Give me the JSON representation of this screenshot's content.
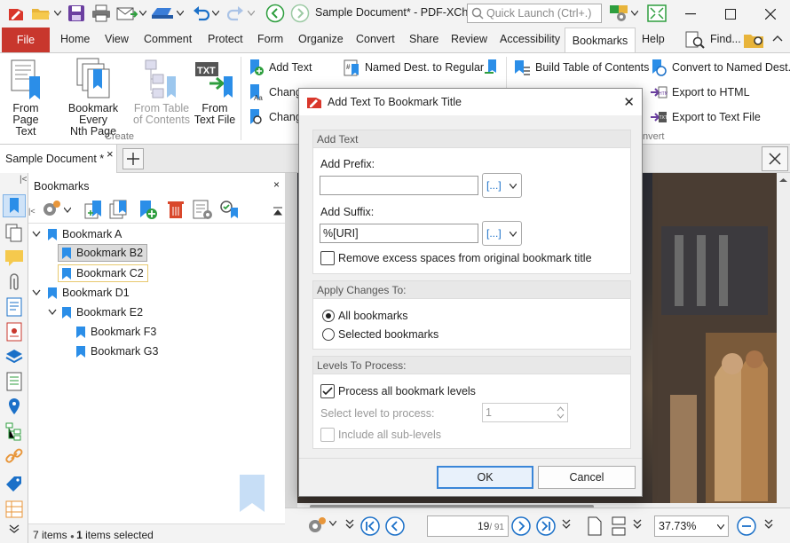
{
  "window": {
    "title": "Sample Document* - PDF-XCh...",
    "quick_launch_placeholder": "Quick Launch (Ctrl+.)"
  },
  "menu": {
    "file": "File",
    "tabs": [
      "Home",
      "View",
      "Comment",
      "Protect",
      "Form",
      "Organize",
      "Convert",
      "Share",
      "Review",
      "Accessibility"
    ],
    "active_tab": "Bookmarks",
    "help": "Help",
    "find": "Find..."
  },
  "ribbon": {
    "create": {
      "from_page_text_1": "From",
      "from_page_text_2": "Page Text",
      "every_nth_1": "Bookmark Every",
      "every_nth_2": "Nth Page",
      "from_toc_1": "From Table",
      "from_toc_2": "of Contents",
      "from_text_file_1": "From",
      "from_text_file_2": "Text File",
      "group_label": "Create"
    },
    "edit": {
      "add_text": "Add Text",
      "change_1": "Chang",
      "change_2": "Chang",
      "named_dest_to_regular": "Named Dest. to Regular",
      "build_toc": "Build Table of Contents",
      "convert_to_named_dest": "Convert to Named Dest.",
      "export_html": "Export to HTML",
      "export_text": "Export to Text File",
      "convert_group_label": "nvert"
    }
  },
  "doc_tab": {
    "label": "Sample Document *"
  },
  "bookmarks_panel": {
    "title": "Bookmarks",
    "close": "×",
    "items": [
      {
        "label": "Bookmark A",
        "level": 0,
        "expanded": true
      },
      {
        "label": "Bookmark B2",
        "level": 1,
        "selected": true
      },
      {
        "label": "Bookmark C2",
        "level": 1,
        "focused": true
      },
      {
        "label": "Bookmark D1",
        "level": 0,
        "expanded": true
      },
      {
        "label": "Bookmark E2",
        "level": 1,
        "expanded": true
      },
      {
        "label": "Bookmark F3",
        "level": 2
      },
      {
        "label": "Bookmark G3",
        "level": 2
      }
    ],
    "status_count": "7 items",
    "status_selected_count": "1",
    "status_selected_label": "items selected"
  },
  "viewer": {
    "page_current": "19",
    "page_total": "/ 91",
    "zoom": "37.73%"
  },
  "dialog": {
    "title": "Add Text To Bookmark Title",
    "section_add_text": "Add Text",
    "prefix_label": "Add Prefix:",
    "prefix_value": "",
    "suffix_label": "Add Suffix:",
    "suffix_value": "%[URI]",
    "macro_glyph": "[...]",
    "remove_spaces_label": "Remove excess spaces from original bookmark title",
    "remove_spaces_checked": false,
    "section_apply": "Apply Changes To:",
    "all_bookmarks": "All bookmarks",
    "selected_bookmarks": "Selected bookmarks",
    "apply_selected": "All bookmarks",
    "section_levels": "Levels To Process:",
    "process_all_levels": "Process all bookmark levels",
    "process_all_checked": true,
    "select_level_label": "Select level to process:",
    "level_value": "1",
    "include_sublevels": "Include all sub-levels",
    "ok": "OK",
    "cancel": "Cancel"
  },
  "colors": {
    "file_tab": "#c8372d",
    "accent_blue": "#1b70c8",
    "bookmark_blue": "#2b8ee8"
  }
}
